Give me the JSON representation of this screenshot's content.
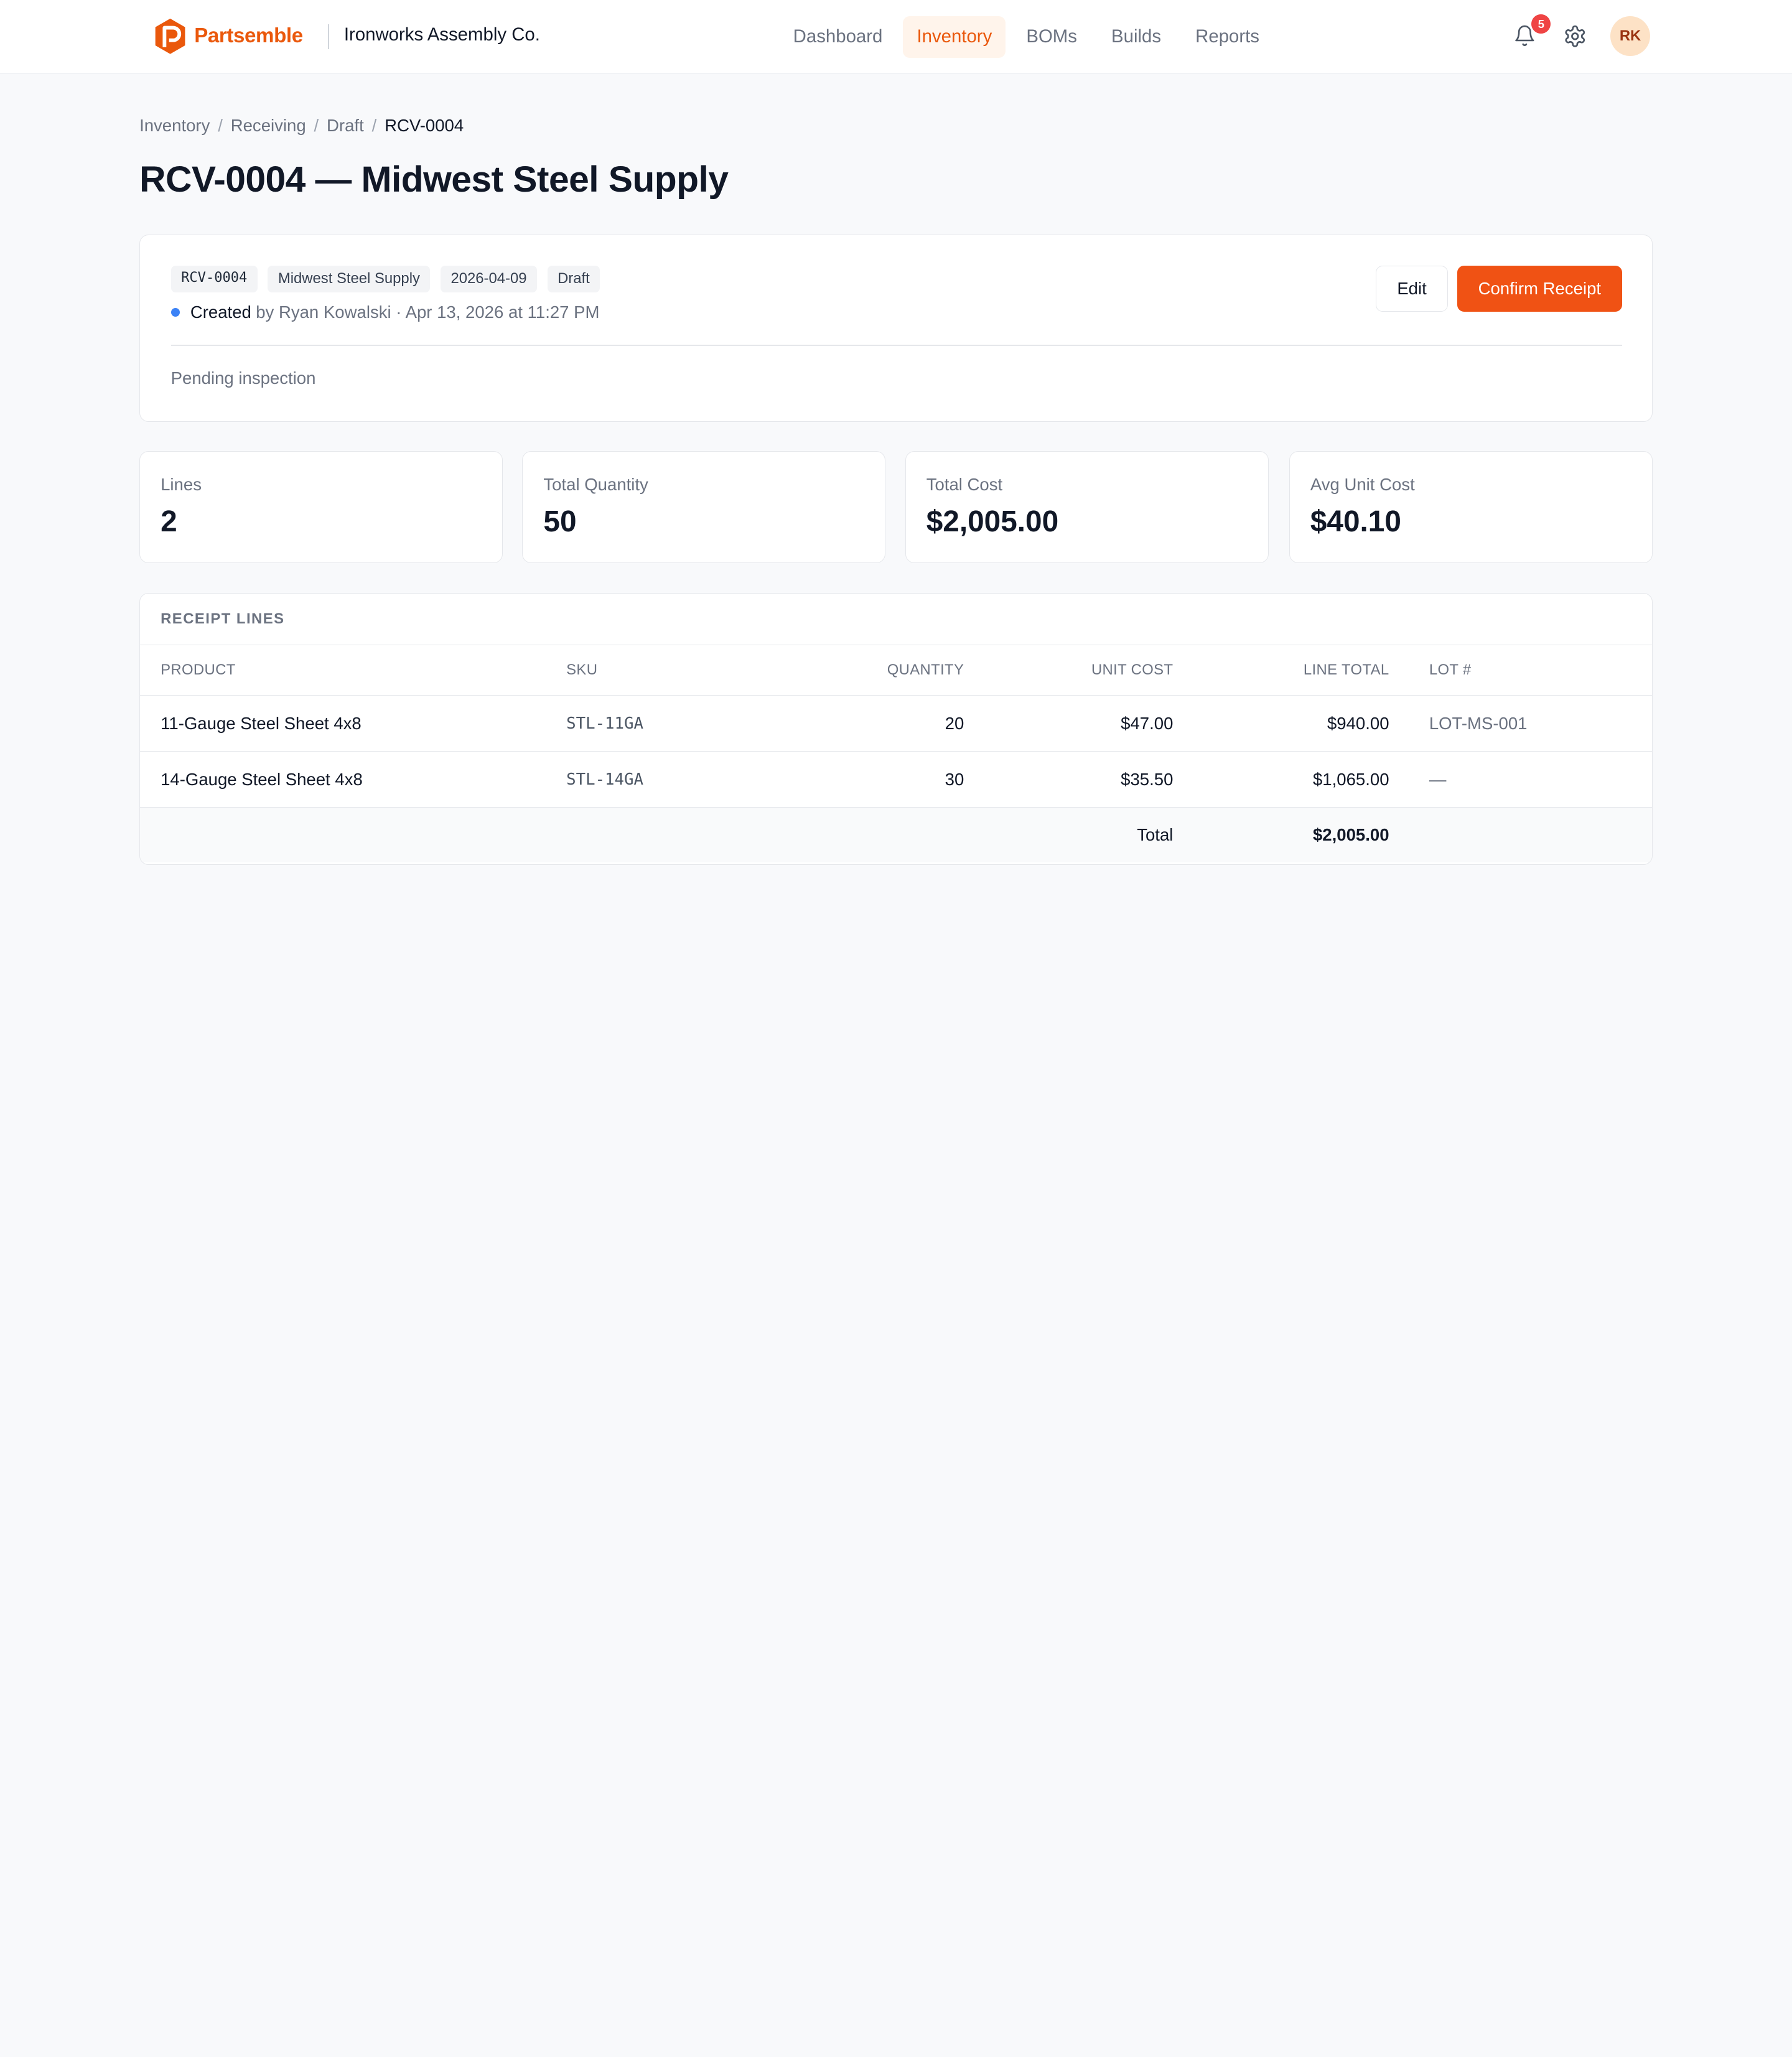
{
  "app": {
    "brand": "Partsemble",
    "company": "Ironworks Assembly Co.",
    "accent": "#ea580c",
    "primary_button": "#f05214"
  },
  "nav": {
    "items": [
      "Dashboard",
      "Inventory",
      "BOMs",
      "Builds",
      "Reports"
    ],
    "active": "Inventory"
  },
  "topbar": {
    "notifications_count": "5",
    "avatar_initials": "RK",
    "icons": [
      "bell-icon",
      "gear-icon"
    ]
  },
  "breadcrumb": [
    "Inventory",
    "Receiving",
    "Draft",
    "RCV-0004"
  ],
  "page": {
    "title": "RCV-0004 — Midwest Steel Supply"
  },
  "receipt": {
    "chips": [
      "RCV-0004",
      "Midwest Steel Supply",
      "2026-04-09",
      "Draft"
    ],
    "status_label": "Created",
    "status_detail": "by Ryan Kowalski · Apr 13, 2026 at 11:27 PM",
    "note": "Pending inspection",
    "actions": {
      "edit": "Edit",
      "confirm": "Confirm Receipt"
    }
  },
  "stats": [
    {
      "label": "Lines",
      "value": "2"
    },
    {
      "label": "Total Quantity",
      "value": "50"
    },
    {
      "label": "Total Cost",
      "value": "$2,005.00"
    },
    {
      "label": "Avg Unit Cost",
      "value": "$40.10"
    }
  ],
  "lines": {
    "title": "RECEIPT LINES",
    "columns": [
      "PRODUCT",
      "SKU",
      "QUANTITY",
      "UNIT COST",
      "LINE TOTAL",
      "LOT #"
    ],
    "rows": [
      {
        "product": "11-Gauge Steel Sheet 4x8",
        "sku": "STL-11GA",
        "quantity": "20",
        "unit_cost": "$47.00",
        "line_total": "$940.00",
        "lot": "LOT-MS-001"
      },
      {
        "product": "14-Gauge Steel Sheet 4x8",
        "sku": "STL-14GA",
        "quantity": "30",
        "unit_cost": "$35.50",
        "line_total": "$1,065.00",
        "lot": "—"
      }
    ],
    "total_label": "Total",
    "total_value": "$2,005.00"
  }
}
